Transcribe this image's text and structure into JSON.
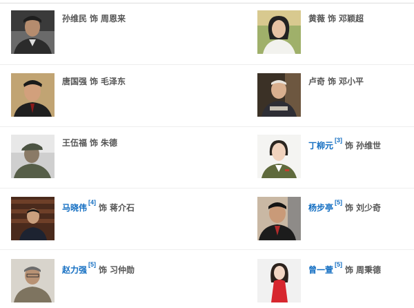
{
  "cast": [
    {
      "actor": "孙维民",
      "ref": "",
      "linked": false,
      "word": "饰",
      "role": "周恩来",
      "photo_icon": "portrait-photo"
    },
    {
      "actor": "黄薇",
      "ref": "",
      "linked": false,
      "word": "饰",
      "role": "邓颖超",
      "photo_icon": "portrait-photo"
    },
    {
      "actor": "唐国强",
      "ref": "",
      "linked": false,
      "word": "饰",
      "role": "毛泽东",
      "photo_icon": "portrait-photo"
    },
    {
      "actor": "卢奇",
      "ref": "",
      "linked": false,
      "word": "饰",
      "role": "邓小平",
      "photo_icon": "portrait-photo"
    },
    {
      "actor": "王伍福",
      "ref": "",
      "linked": false,
      "word": "饰",
      "role": "朱德",
      "photo_icon": "portrait-photo"
    },
    {
      "actor": "丁柳元",
      "ref": "[3]",
      "linked": true,
      "word": "饰",
      "role": "孙维世",
      "photo_icon": "portrait-photo"
    },
    {
      "actor": "马晓伟",
      "ref": "[4]",
      "linked": true,
      "word": "饰",
      "role": "蒋介石",
      "photo_icon": "portrait-photo"
    },
    {
      "actor": "杨步亭",
      "ref": "[5]",
      "linked": true,
      "word": "饰",
      "role": "刘少奇",
      "photo_icon": "portrait-photo"
    },
    {
      "actor": "赵力强",
      "ref": "[5]",
      "linked": true,
      "word": "饰",
      "role": "习仲勋",
      "photo_icon": "portrait-photo"
    },
    {
      "actor": "曾一萱",
      "ref": "[5]",
      "linked": true,
      "word": "饰",
      "role": "周秉德",
      "photo_icon": "portrait-photo"
    }
  ],
  "colors": {
    "link": "#136ec2",
    "text": "#555555",
    "divider": "#eeeeee"
  }
}
